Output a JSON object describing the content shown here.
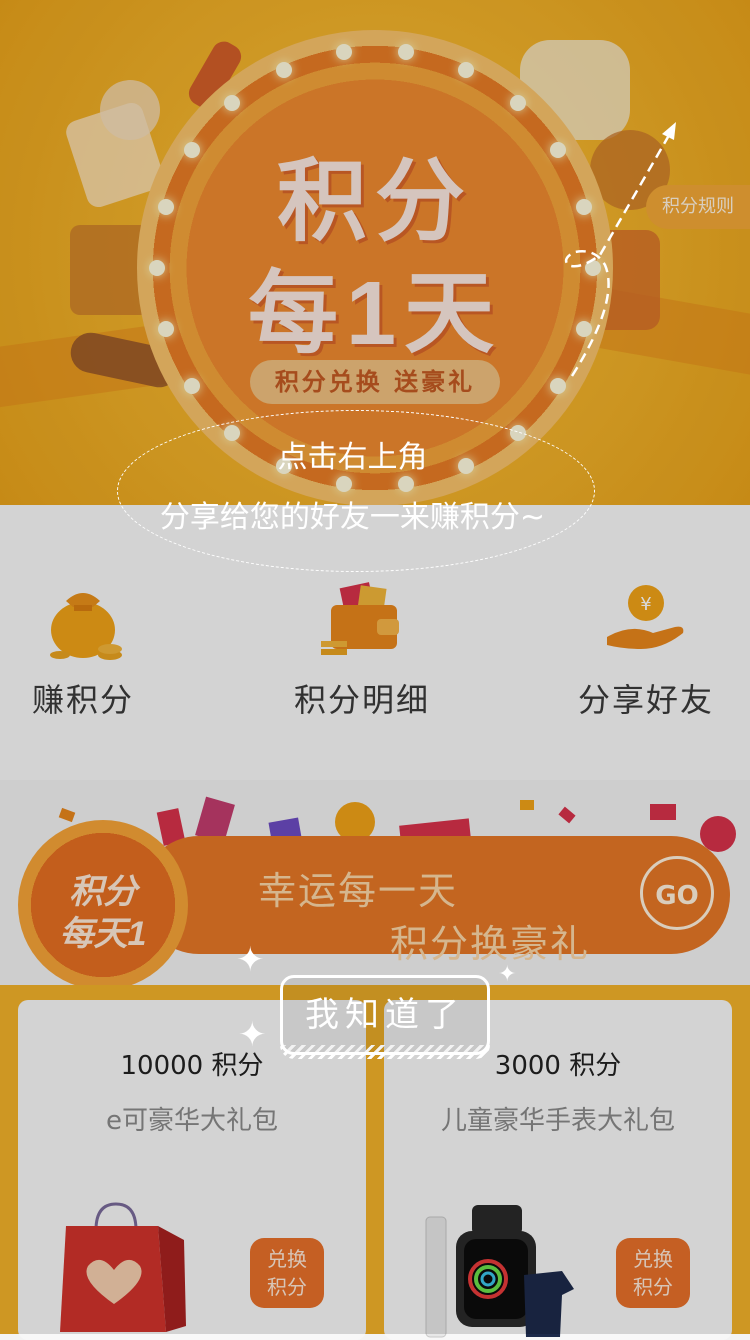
{
  "banner": {
    "title_line1": "积分",
    "title_line2": "每1天",
    "ribbon": "积分兑换 送豪礼",
    "rules_tab": "积分规则"
  },
  "nav": {
    "items": [
      {
        "label": "赚积分",
        "icon": "money-bag-icon"
      },
      {
        "label": "积分明细",
        "icon": "wallet-icon"
      },
      {
        "label": "分享好友",
        "icon": "hand-coin-icon"
      }
    ]
  },
  "promo": {
    "badge_line1": "积分",
    "badge_line2": "每天1",
    "line1": "幸运每一天",
    "line2": "积分换豪礼",
    "go": "GO"
  },
  "products": [
    {
      "price": "10000 积分",
      "name": "e可豪华大礼包",
      "redeem": "兑换\n积分"
    },
    {
      "price": "3000 积分",
      "name": "儿童豪华手表大礼包",
      "redeem": "兑换\n积分"
    }
  ],
  "overlay": {
    "share_line1": "点击右上角",
    "share_line2": "分享给您的好友一来赚积分~",
    "got_it": "我知道了"
  },
  "colors": {
    "banner": "#f2b32b",
    "accent": "#e57726",
    "products_bg": "#f3b22a"
  }
}
